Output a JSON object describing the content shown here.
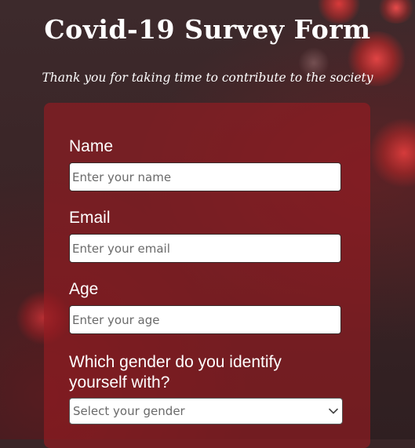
{
  "header": {
    "title": "Covid-19 Survey Form",
    "subtitle": "Thank you for taking time to contribute to the society"
  },
  "form": {
    "name": {
      "label": "Name",
      "placeholder": "Enter your name"
    },
    "email": {
      "label": "Email",
      "placeholder": "Enter your email"
    },
    "age": {
      "label": "Age",
      "placeholder": "Enter your age"
    },
    "gender": {
      "label_line1": "Which gender do you identify",
      "label_line2": "yourself with?",
      "selected": "Select your gender",
      "icon": "chevron-down-icon"
    }
  },
  "colors": {
    "card": "#961c22",
    "accent_blob": "#e04444",
    "text": "#ffffff"
  }
}
